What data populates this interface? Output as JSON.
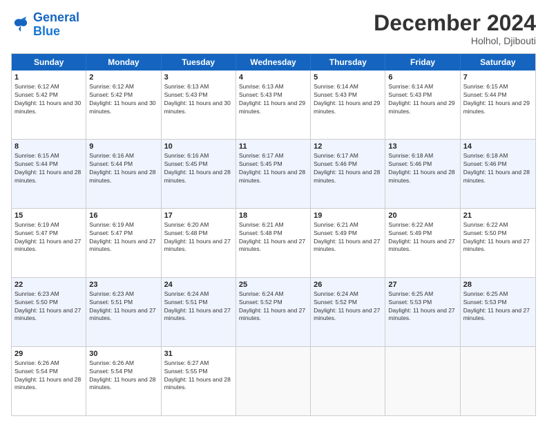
{
  "logo": {
    "line1": "General",
    "line2": "Blue"
  },
  "title": "December 2024",
  "location": "Holhol, Djibouti",
  "days_of_week": [
    "Sunday",
    "Monday",
    "Tuesday",
    "Wednesday",
    "Thursday",
    "Friday",
    "Saturday"
  ],
  "rows": [
    {
      "alt": false,
      "cells": [
        {
          "day": "1",
          "sunrise": "6:12 AM",
          "sunset": "5:42 PM",
          "daylight": "11 hours and 30 minutes."
        },
        {
          "day": "2",
          "sunrise": "6:12 AM",
          "sunset": "5:42 PM",
          "daylight": "11 hours and 30 minutes."
        },
        {
          "day": "3",
          "sunrise": "6:13 AM",
          "sunset": "5:43 PM",
          "daylight": "11 hours and 30 minutes."
        },
        {
          "day": "4",
          "sunrise": "6:13 AM",
          "sunset": "5:43 PM",
          "daylight": "11 hours and 29 minutes."
        },
        {
          "day": "5",
          "sunrise": "6:14 AM",
          "sunset": "5:43 PM",
          "daylight": "11 hours and 29 minutes."
        },
        {
          "day": "6",
          "sunrise": "6:14 AM",
          "sunset": "5:43 PM",
          "daylight": "11 hours and 29 minutes."
        },
        {
          "day": "7",
          "sunrise": "6:15 AM",
          "sunset": "5:44 PM",
          "daylight": "11 hours and 29 minutes."
        }
      ]
    },
    {
      "alt": true,
      "cells": [
        {
          "day": "8",
          "sunrise": "6:15 AM",
          "sunset": "5:44 PM",
          "daylight": "11 hours and 28 minutes."
        },
        {
          "day": "9",
          "sunrise": "6:16 AM",
          "sunset": "5:44 PM",
          "daylight": "11 hours and 28 minutes."
        },
        {
          "day": "10",
          "sunrise": "6:16 AM",
          "sunset": "5:45 PM",
          "daylight": "11 hours and 28 minutes."
        },
        {
          "day": "11",
          "sunrise": "6:17 AM",
          "sunset": "5:45 PM",
          "daylight": "11 hours and 28 minutes."
        },
        {
          "day": "12",
          "sunrise": "6:17 AM",
          "sunset": "5:46 PM",
          "daylight": "11 hours and 28 minutes."
        },
        {
          "day": "13",
          "sunrise": "6:18 AM",
          "sunset": "5:46 PM",
          "daylight": "11 hours and 28 minutes."
        },
        {
          "day": "14",
          "sunrise": "6:18 AM",
          "sunset": "5:46 PM",
          "daylight": "11 hours and 28 minutes."
        }
      ]
    },
    {
      "alt": false,
      "cells": [
        {
          "day": "15",
          "sunrise": "6:19 AM",
          "sunset": "5:47 PM",
          "daylight": "11 hours and 27 minutes."
        },
        {
          "day": "16",
          "sunrise": "6:19 AM",
          "sunset": "5:47 PM",
          "daylight": "11 hours and 27 minutes."
        },
        {
          "day": "17",
          "sunrise": "6:20 AM",
          "sunset": "5:48 PM",
          "daylight": "11 hours and 27 minutes."
        },
        {
          "day": "18",
          "sunrise": "6:21 AM",
          "sunset": "5:48 PM",
          "daylight": "11 hours and 27 minutes."
        },
        {
          "day": "19",
          "sunrise": "6:21 AM",
          "sunset": "5:49 PM",
          "daylight": "11 hours and 27 minutes."
        },
        {
          "day": "20",
          "sunrise": "6:22 AM",
          "sunset": "5:49 PM",
          "daylight": "11 hours and 27 minutes."
        },
        {
          "day": "21",
          "sunrise": "6:22 AM",
          "sunset": "5:50 PM",
          "daylight": "11 hours and 27 minutes."
        }
      ]
    },
    {
      "alt": true,
      "cells": [
        {
          "day": "22",
          "sunrise": "6:23 AM",
          "sunset": "5:50 PM",
          "daylight": "11 hours and 27 minutes."
        },
        {
          "day": "23",
          "sunrise": "6:23 AM",
          "sunset": "5:51 PM",
          "daylight": "11 hours and 27 minutes."
        },
        {
          "day": "24",
          "sunrise": "6:24 AM",
          "sunset": "5:51 PM",
          "daylight": "11 hours and 27 minutes."
        },
        {
          "day": "25",
          "sunrise": "6:24 AM",
          "sunset": "5:52 PM",
          "daylight": "11 hours and 27 minutes."
        },
        {
          "day": "26",
          "sunrise": "6:24 AM",
          "sunset": "5:52 PM",
          "daylight": "11 hours and 27 minutes."
        },
        {
          "day": "27",
          "sunrise": "6:25 AM",
          "sunset": "5:53 PM",
          "daylight": "11 hours and 27 minutes."
        },
        {
          "day": "28",
          "sunrise": "6:25 AM",
          "sunset": "5:53 PM",
          "daylight": "11 hours and 27 minutes."
        }
      ]
    },
    {
      "alt": false,
      "cells": [
        {
          "day": "29",
          "sunrise": "6:26 AM",
          "sunset": "5:54 PM",
          "daylight": "11 hours and 28 minutes."
        },
        {
          "day": "30",
          "sunrise": "6:26 AM",
          "sunset": "5:54 PM",
          "daylight": "11 hours and 28 minutes."
        },
        {
          "day": "31",
          "sunrise": "6:27 AM",
          "sunset": "5:55 PM",
          "daylight": "11 hours and 28 minutes."
        },
        {
          "day": "",
          "sunrise": "",
          "sunset": "",
          "daylight": ""
        },
        {
          "day": "",
          "sunrise": "",
          "sunset": "",
          "daylight": ""
        },
        {
          "day": "",
          "sunrise": "",
          "sunset": "",
          "daylight": ""
        },
        {
          "day": "",
          "sunrise": "",
          "sunset": "",
          "daylight": ""
        }
      ]
    }
  ]
}
